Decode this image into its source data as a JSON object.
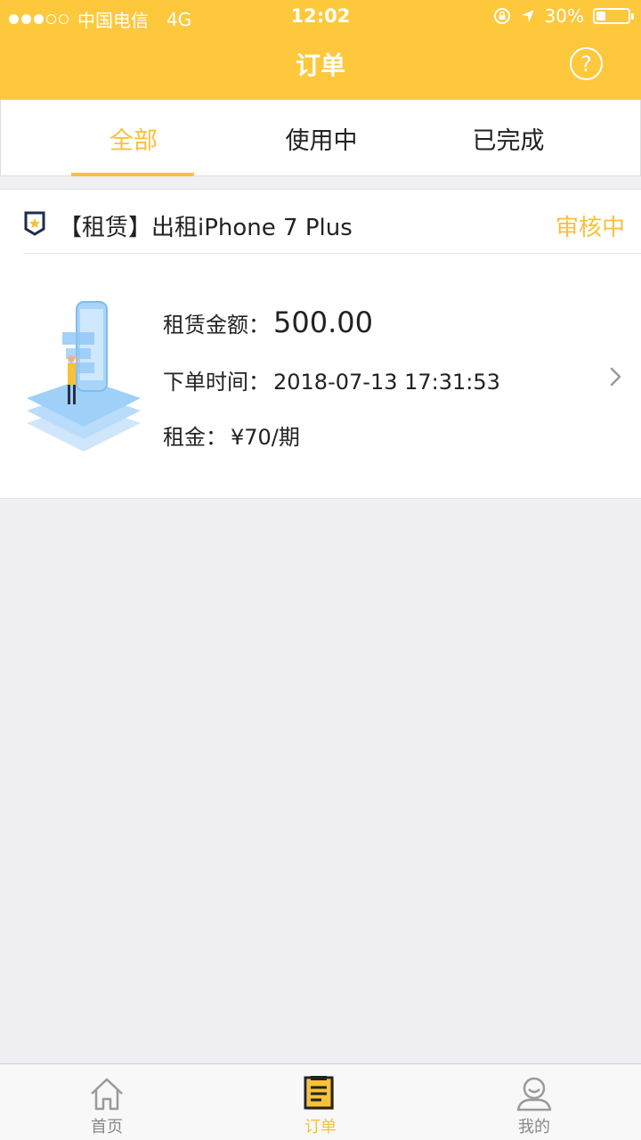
{
  "status_bar": {
    "signal_dots": 5,
    "signal_filled": 3,
    "carrier": "中国电信",
    "network": "4G",
    "time": "12:02",
    "battery": "30%",
    "battery_level": 0.3
  },
  "nav": {
    "title": "订单",
    "help_symbol": "?"
  },
  "tabs": [
    {
      "label": "全部",
      "active": true
    },
    {
      "label": "使用中",
      "active": false
    },
    {
      "label": "已完成",
      "active": false
    }
  ],
  "order": {
    "title": "【租赁】出租iPhone 7 Plus",
    "status": "审核中",
    "amount_label": "租赁金额：",
    "amount_value": "500.00",
    "time_label": "下单时间：",
    "time_value": "2018-07-13 17:31:53",
    "rent_label": "租金：",
    "rent_value": "¥70/期"
  },
  "tabbar": [
    {
      "label": "首页",
      "icon": "home-icon",
      "active": false
    },
    {
      "label": "订单",
      "icon": "order-icon",
      "active": true
    },
    {
      "label": "我的",
      "icon": "profile-icon",
      "active": false
    }
  ],
  "colors": {
    "brand": "#fdc83c",
    "accent": "#f8c13a",
    "background": "#efeff4"
  }
}
